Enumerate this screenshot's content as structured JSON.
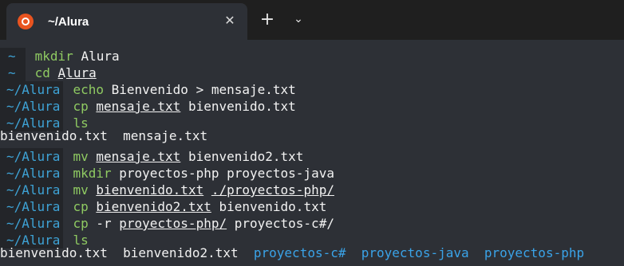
{
  "titlebar": {
    "tab_title": "~/Alura",
    "close_glyph": "✕",
    "new_tab_glyph": "+",
    "dropdown_glyph": "⌄",
    "logo_icon": "ubuntu-logo-icon"
  },
  "terminal": {
    "lines": [
      {
        "prompt": "~",
        "cmd": "mkdir",
        "args": [
          {
            "t": " Alura"
          }
        ]
      },
      {
        "prompt": "~",
        "cmd": "cd",
        "args": [
          {
            "t": " "
          },
          {
            "t": "Alura",
            "u": true
          }
        ]
      },
      {
        "prompt": "~/Alura",
        "cmd": "echo",
        "args": [
          {
            "t": " Bienvenido > mensaje.txt"
          }
        ]
      },
      {
        "prompt": "~/Alura",
        "cmd": "cp",
        "args": [
          {
            "t": " "
          },
          {
            "t": "mensaje.txt",
            "u": true
          },
          {
            "t": " bienvenido.txt"
          }
        ]
      },
      {
        "prompt": "~/Alura",
        "cmd": "ls",
        "args": []
      },
      {
        "output": [
          {
            "t": "bienvenido.txt  mensaje.txt"
          }
        ]
      },
      {
        "prompt": "~/Alura",
        "cmd": "mv",
        "args": [
          {
            "t": " "
          },
          {
            "t": "mensaje.txt",
            "u": true
          },
          {
            "t": " bienvenido2.txt"
          }
        ]
      },
      {
        "prompt": "~/Alura",
        "cmd": "mkdir",
        "args": [
          {
            "t": " proyectos-php proyectos-java"
          }
        ]
      },
      {
        "prompt": "~/Alura",
        "cmd": "mv",
        "args": [
          {
            "t": " "
          },
          {
            "t": "bienvenido.txt",
            "u": true
          },
          {
            "t": " "
          },
          {
            "t": "./proyectos-php/",
            "u": true
          }
        ]
      },
      {
        "prompt": "~/Alura",
        "cmd": "cp",
        "args": [
          {
            "t": " "
          },
          {
            "t": "bienvenido2.txt",
            "u": true
          },
          {
            "t": " bienvenido.txt"
          }
        ]
      },
      {
        "prompt": "~/Alura",
        "cmd": "cp",
        "args": [
          {
            "t": " -r "
          },
          {
            "t": "proyectos-php/",
            "u": true
          },
          {
            "t": " proyectos-c#/"
          }
        ]
      },
      {
        "prompt": "~/Alura",
        "cmd": "ls",
        "args": []
      },
      {
        "output": [
          {
            "t": "bienvenido.txt  bienvenido2.txt  "
          },
          {
            "t": "proyectos-c#",
            "dir": true
          },
          {
            "t": "  "
          },
          {
            "t": "proyectos-java",
            "dir": true
          },
          {
            "t": "  "
          },
          {
            "t": "proyectos-php",
            "dir": true
          }
        ]
      }
    ]
  },
  "colors": {
    "prompt": "#3ea3d6",
    "command": "#8fca62",
    "directory": "#3aa3e8",
    "terminal_bg": "#2d3036"
  }
}
